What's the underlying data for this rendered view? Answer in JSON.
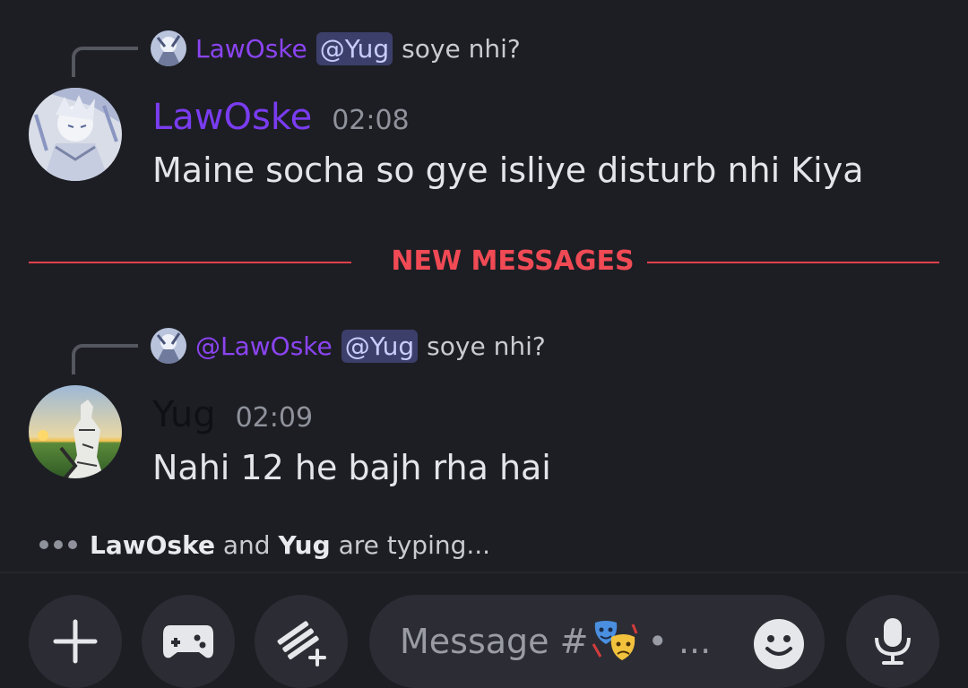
{
  "messages": [
    {
      "reply": {
        "name": "LawOske",
        "mention": "@Yug",
        "text": "soye nhi?"
      },
      "author": "LawOske",
      "author_color": "#7a3cf0",
      "time": "02:08",
      "text": "Maine socha so gye isliye disturb nhi Kiya"
    },
    {
      "reply": {
        "name": "@LawOske",
        "mention": "@Yug",
        "text": "soye nhi?"
      },
      "author": "Yug",
      "author_color": "#0f1016",
      "time": "02:09",
      "text": "Nahi 12 he bajh rha hai"
    }
  ],
  "divider": {
    "label": "NEW MESSAGES",
    "color": "#f04a55"
  },
  "typing": {
    "user1": "LawOske",
    "conj": "and",
    "user2": "Yug",
    "suffix": "are typing..."
  },
  "composer": {
    "placeholder": "Message #",
    "channel_suffix": "• ...",
    "buttons": [
      "plus-icon",
      "gamepad-icon",
      "apps-sparkle-icon"
    ],
    "emoji_icon": "smiley-icon",
    "voice_icon": "microphone-icon"
  },
  "colors": {
    "background": "#1d1e24",
    "mention_bg": "#3c3f6a",
    "reply_name": "#8b44f2"
  }
}
